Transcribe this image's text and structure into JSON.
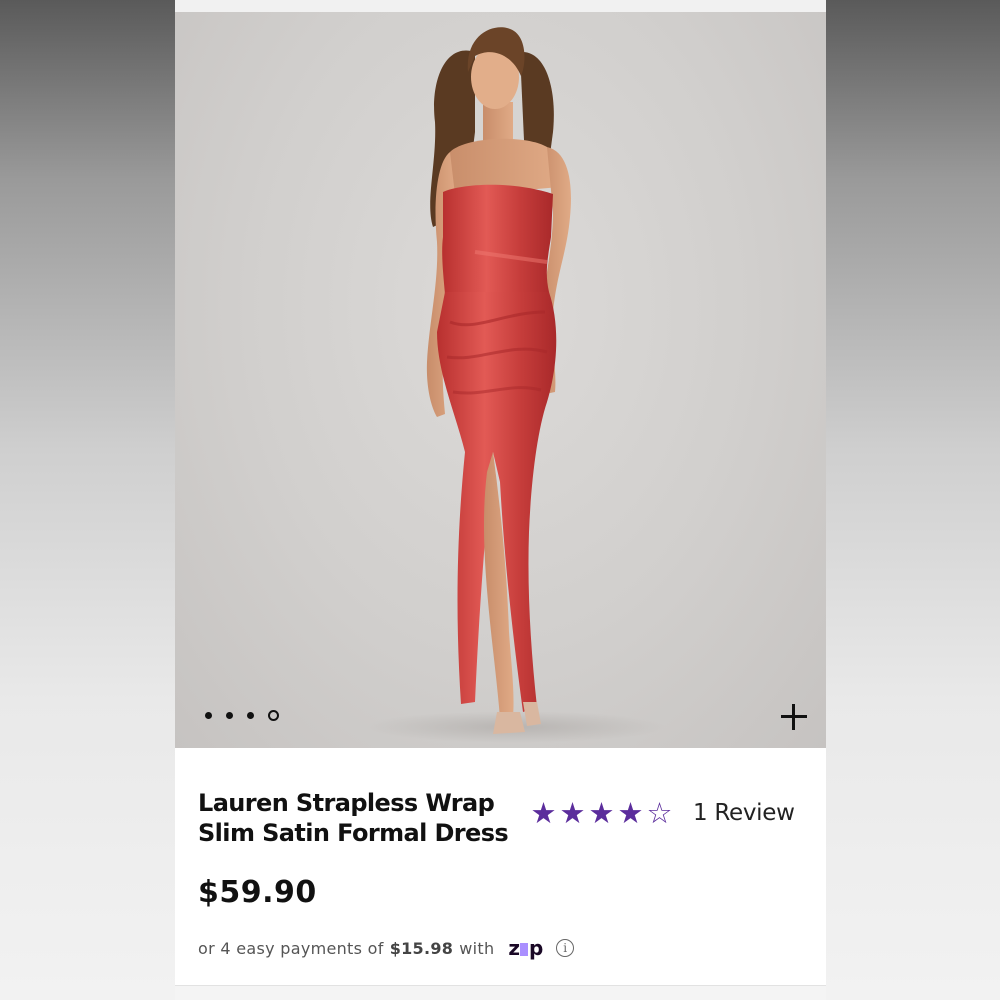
{
  "product": {
    "title": "Lauren Strapless Wrap Slim Satin Formal Dress",
    "rating": 4,
    "rating_max": 5,
    "review_count": "1 Review",
    "price": "$59.90"
  },
  "gallery": {
    "image_alt": "Model wearing red strapless satin wrap maxi dress",
    "slide_count": 4,
    "active_slide": 4,
    "expand_icon": "plus-icon"
  },
  "payments": {
    "prefix": "or 4 easy payments of",
    "amount": "$15.98",
    "suffix": "with",
    "provider": "zip",
    "info_icon": "info-icon"
  },
  "colors": {
    "star": "#5b2d9c",
    "zip_accent": "#aa8fff",
    "dress": "#c8403f"
  }
}
